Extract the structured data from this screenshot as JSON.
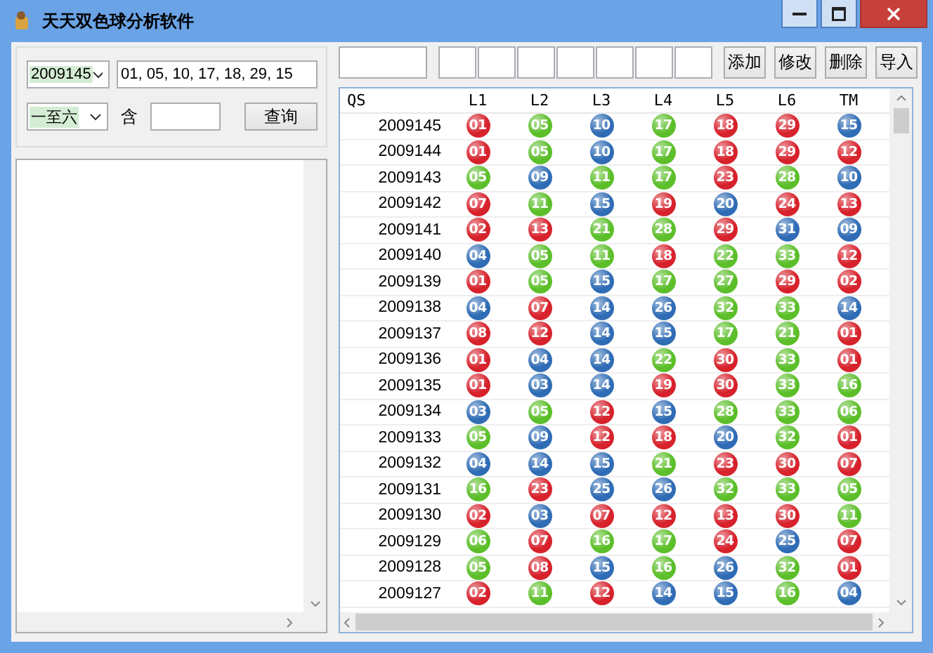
{
  "window": {
    "title": "天天双色球分析软件"
  },
  "query": {
    "issue_select": {
      "value": "2009145"
    },
    "numbers_field": {
      "value": "01, 05, 10, 17, 18, 29, 15"
    },
    "range_select": {
      "value": "一至六"
    },
    "contains_label": "含",
    "query_button": "查询"
  },
  "buttons": [
    "添加",
    "修改",
    "删除",
    "导入"
  ],
  "table": {
    "columns": [
      "QS",
      "L1",
      "L2",
      "L3",
      "L4",
      "L5",
      "L6",
      "TM"
    ],
    "rows": [
      {
        "qs": "2009145",
        "balls": [
          {
            "n": "01",
            "color": "#d7222c"
          },
          {
            "n": "05",
            "color": "#5cbf2a"
          },
          {
            "n": "10",
            "color": "#2f6cb5"
          },
          {
            "n": "17",
            "color": "#5cbf2a"
          },
          {
            "n": "18",
            "color": "#d7222c"
          },
          {
            "n": "29",
            "color": "#d7222c"
          },
          {
            "n": "15",
            "color": "#2f6cb5"
          }
        ]
      },
      {
        "qs": "2009144",
        "balls": [
          {
            "n": "01",
            "color": "#d7222c"
          },
          {
            "n": "05",
            "color": "#5cbf2a"
          },
          {
            "n": "10",
            "color": "#2f6cb5"
          },
          {
            "n": "17",
            "color": "#5cbf2a"
          },
          {
            "n": "18",
            "color": "#d7222c"
          },
          {
            "n": "29",
            "color": "#d7222c"
          },
          {
            "n": "12",
            "color": "#d7222c"
          }
        ]
      },
      {
        "qs": "2009143",
        "balls": [
          {
            "n": "05",
            "color": "#5cbf2a"
          },
          {
            "n": "09",
            "color": "#2f6cb5"
          },
          {
            "n": "11",
            "color": "#5cbf2a"
          },
          {
            "n": "17",
            "color": "#5cbf2a"
          },
          {
            "n": "23",
            "color": "#d7222c"
          },
          {
            "n": "28",
            "color": "#5cbf2a"
          },
          {
            "n": "10",
            "color": "#2f6cb5"
          }
        ]
      },
      {
        "qs": "2009142",
        "balls": [
          {
            "n": "07",
            "color": "#d7222c"
          },
          {
            "n": "11",
            "color": "#5cbf2a"
          },
          {
            "n": "15",
            "color": "#2f6cb5"
          },
          {
            "n": "19",
            "color": "#d7222c"
          },
          {
            "n": "20",
            "color": "#2f6cb5"
          },
          {
            "n": "24",
            "color": "#d7222c"
          },
          {
            "n": "13",
            "color": "#d7222c"
          }
        ]
      },
      {
        "qs": "2009141",
        "balls": [
          {
            "n": "02",
            "color": "#d7222c"
          },
          {
            "n": "13",
            "color": "#d7222c"
          },
          {
            "n": "21",
            "color": "#5cbf2a"
          },
          {
            "n": "28",
            "color": "#5cbf2a"
          },
          {
            "n": "29",
            "color": "#d7222c"
          },
          {
            "n": "31",
            "color": "#2f6cb5"
          },
          {
            "n": "09",
            "color": "#2f6cb5"
          }
        ]
      },
      {
        "qs": "2009140",
        "balls": [
          {
            "n": "04",
            "color": "#2f6cb5"
          },
          {
            "n": "05",
            "color": "#5cbf2a"
          },
          {
            "n": "11",
            "color": "#5cbf2a"
          },
          {
            "n": "18",
            "color": "#d7222c"
          },
          {
            "n": "22",
            "color": "#5cbf2a"
          },
          {
            "n": "33",
            "color": "#5cbf2a"
          },
          {
            "n": "12",
            "color": "#d7222c"
          }
        ]
      },
      {
        "qs": "2009139",
        "balls": [
          {
            "n": "01",
            "color": "#d7222c"
          },
          {
            "n": "05",
            "color": "#5cbf2a"
          },
          {
            "n": "15",
            "color": "#2f6cb5"
          },
          {
            "n": "17",
            "color": "#5cbf2a"
          },
          {
            "n": "27",
            "color": "#5cbf2a"
          },
          {
            "n": "29",
            "color": "#d7222c"
          },
          {
            "n": "02",
            "color": "#d7222c"
          }
        ]
      },
      {
        "qs": "2009138",
        "balls": [
          {
            "n": "04",
            "color": "#2f6cb5"
          },
          {
            "n": "07",
            "color": "#d7222c"
          },
          {
            "n": "14",
            "color": "#2f6cb5"
          },
          {
            "n": "26",
            "color": "#2f6cb5"
          },
          {
            "n": "32",
            "color": "#5cbf2a"
          },
          {
            "n": "33",
            "color": "#5cbf2a"
          },
          {
            "n": "14",
            "color": "#2f6cb5"
          }
        ]
      },
      {
        "qs": "2009137",
        "balls": [
          {
            "n": "08",
            "color": "#d7222c"
          },
          {
            "n": "12",
            "color": "#d7222c"
          },
          {
            "n": "14",
            "color": "#2f6cb5"
          },
          {
            "n": "15",
            "color": "#2f6cb5"
          },
          {
            "n": "17",
            "color": "#5cbf2a"
          },
          {
            "n": "21",
            "color": "#5cbf2a"
          },
          {
            "n": "01",
            "color": "#d7222c"
          }
        ]
      },
      {
        "qs": "2009136",
        "balls": [
          {
            "n": "01",
            "color": "#d7222c"
          },
          {
            "n": "04",
            "color": "#2f6cb5"
          },
          {
            "n": "14",
            "color": "#2f6cb5"
          },
          {
            "n": "22",
            "color": "#5cbf2a"
          },
          {
            "n": "30",
            "color": "#d7222c"
          },
          {
            "n": "33",
            "color": "#5cbf2a"
          },
          {
            "n": "01",
            "color": "#d7222c"
          }
        ]
      },
      {
        "qs": "2009135",
        "balls": [
          {
            "n": "01",
            "color": "#d7222c"
          },
          {
            "n": "03",
            "color": "#2f6cb5"
          },
          {
            "n": "14",
            "color": "#2f6cb5"
          },
          {
            "n": "19",
            "color": "#d7222c"
          },
          {
            "n": "30",
            "color": "#d7222c"
          },
          {
            "n": "33",
            "color": "#5cbf2a"
          },
          {
            "n": "16",
            "color": "#5cbf2a"
          }
        ]
      },
      {
        "qs": "2009134",
        "balls": [
          {
            "n": "03",
            "color": "#2f6cb5"
          },
          {
            "n": "05",
            "color": "#5cbf2a"
          },
          {
            "n": "12",
            "color": "#d7222c"
          },
          {
            "n": "15",
            "color": "#2f6cb5"
          },
          {
            "n": "28",
            "color": "#5cbf2a"
          },
          {
            "n": "33",
            "color": "#5cbf2a"
          },
          {
            "n": "06",
            "color": "#5cbf2a"
          }
        ]
      },
      {
        "qs": "2009133",
        "balls": [
          {
            "n": "05",
            "color": "#5cbf2a"
          },
          {
            "n": "09",
            "color": "#2f6cb5"
          },
          {
            "n": "12",
            "color": "#d7222c"
          },
          {
            "n": "18",
            "color": "#d7222c"
          },
          {
            "n": "20",
            "color": "#2f6cb5"
          },
          {
            "n": "32",
            "color": "#5cbf2a"
          },
          {
            "n": "01",
            "color": "#d7222c"
          }
        ]
      },
      {
        "qs": "2009132",
        "balls": [
          {
            "n": "04",
            "color": "#2f6cb5"
          },
          {
            "n": "14",
            "color": "#2f6cb5"
          },
          {
            "n": "15",
            "color": "#2f6cb5"
          },
          {
            "n": "21",
            "color": "#5cbf2a"
          },
          {
            "n": "23",
            "color": "#d7222c"
          },
          {
            "n": "30",
            "color": "#d7222c"
          },
          {
            "n": "07",
            "color": "#d7222c"
          }
        ]
      },
      {
        "qs": "2009131",
        "balls": [
          {
            "n": "16",
            "color": "#5cbf2a"
          },
          {
            "n": "23",
            "color": "#d7222c"
          },
          {
            "n": "25",
            "color": "#2f6cb5"
          },
          {
            "n": "26",
            "color": "#2f6cb5"
          },
          {
            "n": "32",
            "color": "#5cbf2a"
          },
          {
            "n": "33",
            "color": "#5cbf2a"
          },
          {
            "n": "05",
            "color": "#5cbf2a"
          }
        ]
      },
      {
        "qs": "2009130",
        "balls": [
          {
            "n": "02",
            "color": "#d7222c"
          },
          {
            "n": "03",
            "color": "#2f6cb5"
          },
          {
            "n": "07",
            "color": "#d7222c"
          },
          {
            "n": "12",
            "color": "#d7222c"
          },
          {
            "n": "13",
            "color": "#d7222c"
          },
          {
            "n": "30",
            "color": "#d7222c"
          },
          {
            "n": "11",
            "color": "#5cbf2a"
          }
        ]
      },
      {
        "qs": "2009129",
        "balls": [
          {
            "n": "06",
            "color": "#5cbf2a"
          },
          {
            "n": "07",
            "color": "#d7222c"
          },
          {
            "n": "16",
            "color": "#5cbf2a"
          },
          {
            "n": "17",
            "color": "#5cbf2a"
          },
          {
            "n": "24",
            "color": "#d7222c"
          },
          {
            "n": "25",
            "color": "#2f6cb5"
          },
          {
            "n": "07",
            "color": "#d7222c"
          }
        ]
      },
      {
        "qs": "2009128",
        "balls": [
          {
            "n": "05",
            "color": "#5cbf2a"
          },
          {
            "n": "08",
            "color": "#d7222c"
          },
          {
            "n": "15",
            "color": "#2f6cb5"
          },
          {
            "n": "16",
            "color": "#5cbf2a"
          },
          {
            "n": "26",
            "color": "#2f6cb5"
          },
          {
            "n": "32",
            "color": "#5cbf2a"
          },
          {
            "n": "01",
            "color": "#d7222c"
          }
        ]
      },
      {
        "qs": "2009127",
        "balls": [
          {
            "n": "02",
            "color": "#d7222c"
          },
          {
            "n": "11",
            "color": "#5cbf2a"
          },
          {
            "n": "12",
            "color": "#d7222c"
          },
          {
            "n": "14",
            "color": "#2f6cb5"
          },
          {
            "n": "15",
            "color": "#2f6cb5"
          },
          {
            "n": "16",
            "color": "#5cbf2a"
          },
          {
            "n": "04",
            "color": "#2f6cb5"
          }
        ]
      }
    ]
  }
}
